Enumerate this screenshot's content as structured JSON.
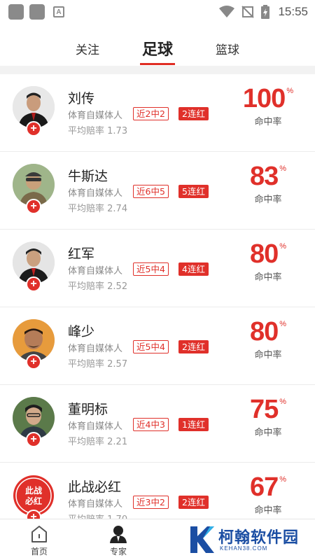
{
  "status_bar": {
    "time": "15:55",
    "icons": [
      "app-icon",
      "app-icon",
      "a-box-icon",
      "wifi-icon",
      "no-signal-icon",
      "battery-charging-icon"
    ]
  },
  "tabs": [
    {
      "label": "关注",
      "active": false
    },
    {
      "label": "足球",
      "active": true
    },
    {
      "label": "篮球",
      "active": false
    }
  ],
  "experts": [
    {
      "name": "刘传",
      "role": "体育自媒体人",
      "recent": "近2中2",
      "streak": "2连红",
      "odds_label": "平均赔率",
      "odds": "1.73",
      "rate": "100",
      "rate_unit": "%",
      "rate_label": "命中率"
    },
    {
      "name": "牛斯达",
      "role": "体育自媒体人",
      "recent": "近6中5",
      "streak": "5连红",
      "odds_label": "平均赔率",
      "odds": "2.74",
      "rate": "83",
      "rate_unit": "%",
      "rate_label": "命中率"
    },
    {
      "name": "红军",
      "role": "体育自媒体人",
      "recent": "近5中4",
      "streak": "4连红",
      "odds_label": "平均赔率",
      "odds": "2.52",
      "rate": "80",
      "rate_unit": "%",
      "rate_label": "命中率"
    },
    {
      "name": "峰少",
      "role": "体育自媒体人",
      "recent": "近5中4",
      "streak": "2连红",
      "odds_label": "平均赔率",
      "odds": "2.57",
      "rate": "80",
      "rate_unit": "%",
      "rate_label": "命中率"
    },
    {
      "name": "董明标",
      "role": "体育自媒体人",
      "recent": "近4中3",
      "streak": "1连红",
      "odds_label": "平均赔率",
      "odds": "2.21",
      "rate": "75",
      "rate_unit": "%",
      "rate_label": "命中率"
    },
    {
      "name": "此战必红",
      "role": "体育自媒体人",
      "recent": "近3中2",
      "streak": "2连红",
      "odds_label": "平均赔率",
      "odds": "1.70",
      "rate": "67",
      "rate_unit": "%",
      "rate_label": "命中率",
      "avatar_text": "此战必红"
    }
  ],
  "bottom_nav": [
    {
      "label": "首页",
      "icon": "home-icon"
    },
    {
      "label": "专家",
      "icon": "person-icon"
    }
  ],
  "watermark": {
    "title": "柯翰软件园",
    "subtitle": "KEHAN38.COM"
  },
  "colors": {
    "accent": "#e0302a",
    "brand_blue": "#1b4ea3"
  }
}
